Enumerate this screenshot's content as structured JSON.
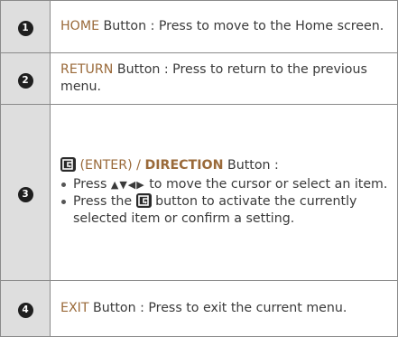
{
  "rows": [
    {
      "number": "1",
      "keyword": "HOME",
      "text": " Button : Press to move to the Home screen."
    },
    {
      "number": "2",
      "keyword": "RETURN",
      "text": " Button : Press to return to the previous menu."
    },
    {
      "number": "3",
      "enter_icon": "enter-button-icon",
      "enter_label": "(ENTER) /",
      "direction_label": "DIRECTION",
      "heading_suffix": " Button :",
      "bullet1_pre": "Press",
      "bullet1_arrows": "▲▼◀▶",
      "bullet1_post": " to move the cursor or select an item.",
      "bullet2_pre": "Press the",
      "bullet2_post": " button to activate the currently selected item or confirm a setting."
    },
    {
      "number": "4",
      "keyword": "EXIT",
      "text": " Button : Press to exit the current menu."
    }
  ]
}
